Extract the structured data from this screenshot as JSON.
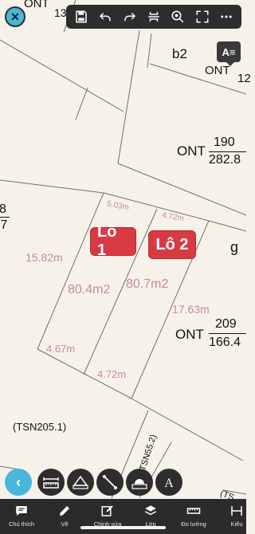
{
  "map": {
    "labels": {
      "ont_top": "ONT",
      "num_top": "13",
      "b2": "b2",
      "ont_right": "ONT",
      "num_right": "12",
      "ont_190": "ONT",
      "area_190_num": "190",
      "area_190_size": "282.8",
      "left_8": "8",
      "left_7": ".7",
      "g": "g",
      "ont_209": "ONT",
      "area_209_num": "209",
      "area_209_size": "166.4",
      "tsn_label": "(TSN205.1)",
      "tsn_road": "(TSN55.2)",
      "tsn_corner": "(TS"
    },
    "measurements": {
      "top_width_1": "5.03m",
      "top_width_2": "4.72m",
      "left_side": "15.82m",
      "area_1": "80.4m2",
      "area_2": "80.7m2",
      "right_side": "17.63m",
      "bottom_width_1": "4.67m",
      "bottom_width_2": "4.72m"
    }
  },
  "lots": {
    "lot1": "Lô 1",
    "lot2": "Lô 2"
  },
  "toolbar": {
    "close_icon": "close-icon",
    "text_mode": "A≡"
  },
  "bottom_nav": {
    "items": [
      {
        "label": "Chú thích",
        "icon": "comment-icon"
      },
      {
        "label": "Vẽ",
        "icon": "pencil-icon"
      },
      {
        "label": "Chỉnh sửa",
        "icon": "edit-icon"
      },
      {
        "label": "Lớp",
        "icon": "layers-icon"
      },
      {
        "label": "Đo lường",
        "icon": "ruler-icon"
      },
      {
        "label": "Kiểu",
        "icon": "style-icon"
      }
    ]
  },
  "colors": {
    "map_bg": "#f6f2ea",
    "parcel_line": "#6f6f6f",
    "measure_text": "#c98b8b",
    "lot_badge": "#d83a44",
    "accent": "#4ab6d9",
    "toolbar_bg": "#2d2d2d"
  }
}
